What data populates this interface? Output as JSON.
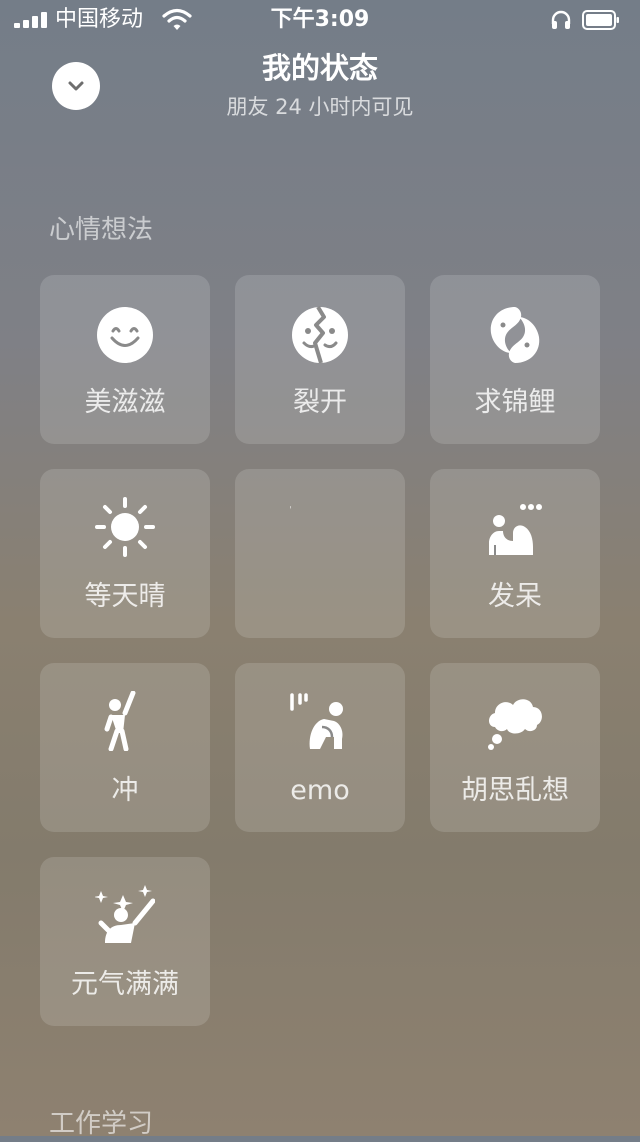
{
  "status_bar": {
    "carrier": "中国移动",
    "time": "下午3:09",
    "signal_icon": "signal-bars-icon",
    "wifi_icon": "wifi-icon",
    "headphone_icon": "headphone-icon",
    "battery_icon": "battery-icon"
  },
  "header": {
    "title": "我的状态",
    "subtitle": "朋友 24 小时内可见",
    "collapse_icon": "chevron-down-icon"
  },
  "sections": {
    "mood": {
      "title": "心情想法"
    },
    "work": {
      "title": "工作学习"
    }
  },
  "moods": [
    {
      "label": "美滋滋",
      "icon": "smile-icon"
    },
    {
      "label": "裂开",
      "icon": "cracked-face-icon"
    },
    {
      "label": "求锦鲤",
      "icon": "koi-icon"
    },
    {
      "label": "等天晴",
      "icon": "sun-icon"
    },
    {
      "label": "",
      "icon": "blank-icon"
    },
    {
      "label": "发呆",
      "icon": "daze-icon"
    },
    {
      "label": "冲",
      "icon": "cheer-person-icon"
    },
    {
      "label": "emo",
      "icon": "sad-person-icon"
    },
    {
      "label": "胡思乱想",
      "icon": "thought-cloud-icon"
    },
    {
      "label": "元气满满",
      "icon": "energetic-person-icon"
    }
  ],
  "colors": {
    "background_top": "#747d88",
    "background_bottom": "#8e8170",
    "tile": "rgba(255,255,255,0.14)",
    "icon": "#ffffff"
  }
}
